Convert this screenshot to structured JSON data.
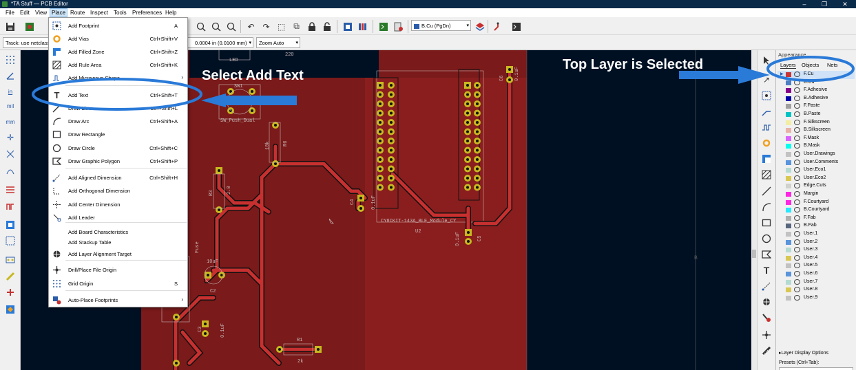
{
  "window": {
    "title": "*TA Stuff — PCB Editor",
    "minimize": "–",
    "maximize": "❐",
    "close": "✕"
  },
  "menubar": [
    "File",
    "Edit",
    "View",
    "Place",
    "Route",
    "Inspect",
    "Tools",
    "Preferences",
    "Help"
  ],
  "optionbar": {
    "track": "Track: use netclass",
    "grid": "0.0004 in (0.0100 mm)",
    "zoom": "Zoom Auto",
    "active_layer": "B.Cu (PgDn)"
  },
  "place_menu": [
    {
      "label": "Add Footprint",
      "shortcut": "A",
      "icon": "footprint-icon"
    },
    {
      "label": "Add Vias",
      "shortcut": "Ctrl+Shift+V",
      "icon": "via-icon"
    },
    {
      "label": "Add Filled Zone",
      "shortcut": "Ctrl+Shift+Z",
      "icon": "zone-icon"
    },
    {
      "label": "Add Rule Area",
      "shortcut": "Ctrl+Shift+K",
      "icon": "rule-area-icon"
    },
    {
      "label": "Add Microwave Shape",
      "shortcut": "",
      "submenu": true,
      "icon": "microwave-icon"
    },
    {
      "label": "Add Text",
      "shortcut": "Ctrl+Shift+T",
      "icon": "text-icon"
    },
    {
      "label": "Draw Line",
      "shortcut": "Ctrl+Shift+L",
      "icon": "line-icon"
    },
    {
      "label": "Draw Arc",
      "shortcut": "Ctrl+Shift+A",
      "icon": "arc-icon"
    },
    {
      "label": "Draw Rectangle",
      "shortcut": "",
      "icon": "rectangle-icon"
    },
    {
      "label": "Draw Circle",
      "shortcut": "Ctrl+Shift+C",
      "icon": "circle-icon"
    },
    {
      "label": "Draw Graphic Polygon",
      "shortcut": "Ctrl+Shift+P",
      "icon": "polygon-icon"
    },
    {
      "label": "Add Aligned Dimension",
      "shortcut": "Ctrl+Shift+H",
      "icon": "aligned-dimension-icon"
    },
    {
      "label": "Add Orthogonal Dimension",
      "shortcut": "",
      "icon": "orthogonal-dimension-icon"
    },
    {
      "label": "Add Center Dimension",
      "shortcut": "",
      "icon": "center-dimension-icon"
    },
    {
      "label": "Add Leader",
      "shortcut": "",
      "icon": "leader-icon"
    },
    {
      "label": "Add Board Characteristics",
      "shortcut": "",
      "icon": ""
    },
    {
      "label": "Add Stackup Table",
      "shortcut": "",
      "icon": ""
    },
    {
      "label": "Add Layer Alignment Target",
      "shortcut": "",
      "icon": "alignment-target-icon"
    },
    {
      "label": "Drill/Place File Origin",
      "shortcut": "",
      "icon": "drill-origin-icon"
    },
    {
      "label": "Grid Origin",
      "shortcut": "S",
      "icon": "grid-origin-icon"
    },
    {
      "label": "Auto-Place Footprints",
      "shortcut": "",
      "submenu": true,
      "icon": "autoplace-icon"
    }
  ],
  "appearance": {
    "title": "Appearance",
    "tabs": [
      "Layers",
      "Objects",
      "Nets"
    ],
    "layers": [
      {
        "name": "F.Cu",
        "color": "#c83434",
        "selected": true
      },
      {
        "name": "B.Cu",
        "color": "#4d7fc4"
      },
      {
        "name": "F.Adhesive",
        "color": "#84008a"
      },
      {
        "name": "B.Adhesive",
        "color": "#0000a8"
      },
      {
        "name": "F.Paste",
        "color": "#a0a0a0"
      },
      {
        "name": "B.Paste",
        "color": "#00c2c2"
      },
      {
        "name": "F.Silkscreen",
        "color": "#f2eda1"
      },
      {
        "name": "B.Silkscreen",
        "color": "#e8b2a7"
      },
      {
        "name": "F.Mask",
        "color": "#d864ff"
      },
      {
        "name": "B.Mask",
        "color": "#02ffee"
      },
      {
        "name": "User.Drawings",
        "color": "#c2c2c2"
      },
      {
        "name": "User.Comments",
        "color": "#5994dc"
      },
      {
        "name": "User.Eco1",
        "color": "#b4dbd2"
      },
      {
        "name": "User.Eco2",
        "color": "#d8c852"
      },
      {
        "name": "Edge.Cuts",
        "color": "#d0d2cd"
      },
      {
        "name": "Margin",
        "color": "#ff26e2"
      },
      {
        "name": "F.Courtyard",
        "color": "#ff26e2"
      },
      {
        "name": "B.Courtyard",
        "color": "#26e9ff"
      },
      {
        "name": "F.Fab",
        "color": "#afafaf"
      },
      {
        "name": "B.Fab",
        "color": "#58657f"
      },
      {
        "name": "User.1",
        "color": "#c2c2c2"
      },
      {
        "name": "User.2",
        "color": "#5994dc"
      },
      {
        "name": "User.3",
        "color": "#b4dbd2"
      },
      {
        "name": "User.4",
        "color": "#d8c852"
      },
      {
        "name": "User.5",
        "color": "#c2c2c2"
      },
      {
        "name": "User.6",
        "color": "#5994dc"
      },
      {
        "name": "User.7",
        "color": "#b4dbd2"
      },
      {
        "name": "User.8",
        "color": "#d8c852"
      },
      {
        "name": "User.9",
        "color": "#c2c2c2"
      }
    ],
    "layer_display_options": "Layer Display Options",
    "presets": "Presets (Ctrl+Tab):"
  },
  "annotations": {
    "select_add_text": "Select Add Text",
    "top_layer_selected": "Top Layer is Selected"
  },
  "board_labels": {
    "sw1": "SW1",
    "sw_push": "SW_Push_Dual",
    "led": "LED",
    "r220": "220",
    "r6": "R6",
    "r6_val": "10k",
    "r3": "R3",
    "r3_val": "2.0",
    "fuse": "Fuse",
    "c2": "C2",
    "c2_val": "10uF",
    "c3": "C3",
    "c3_val": "0.1uF",
    "c4": "C4",
    "c4_val": "0.1uF",
    "c5": "C5",
    "c5_val": "0.1uF",
    "c6": "C6",
    "c6_val": "0.1uF",
    "r1": "R1",
    "r1_val": "2k",
    "module": "CY8CKIT-143A_BLE_Module_CY",
    "u2": "U2",
    "b_label": "B"
  },
  "colors": {
    "board_fill": "#7a1a1a",
    "copper_track": "#c83030",
    "canvas_bg": "#001023",
    "pad": "#c8b820",
    "annotation_blue": "#2a7ad8"
  }
}
